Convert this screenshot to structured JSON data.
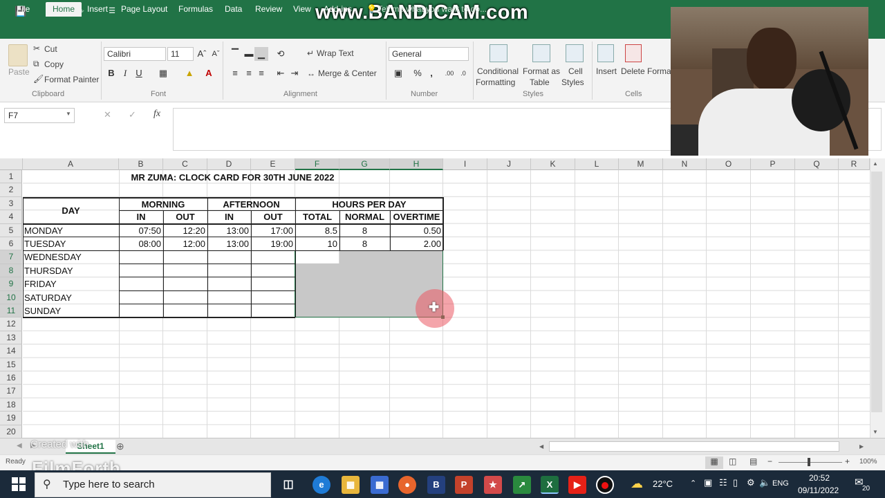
{
  "watermark": "www.BANDICAM.com",
  "filmforth": {
    "line1": "Created with",
    "line2": "FilmForth"
  },
  "ribbon_tabs": [
    "File",
    "Home",
    "Insert",
    "Page Layout",
    "Formulas",
    "Data",
    "Review",
    "View",
    "Add-ins"
  ],
  "tell_me": "Tell me what you want to do...",
  "clipboard": {
    "paste": "Paste",
    "cut": "Cut",
    "copy": "Copy",
    "format_painter": "Format Painter",
    "group": "Clipboard"
  },
  "font": {
    "name": "Calibri",
    "size": "11",
    "group": "Font",
    "bold": "B",
    "italic": "I",
    "underline": "U"
  },
  "alignment": {
    "wrap": "Wrap Text",
    "merge": "Merge & Center",
    "group": "Alignment"
  },
  "number": {
    "format": "General",
    "group": "Number",
    "percent": "%",
    "comma": ","
  },
  "styles": {
    "cond1": "Conditional",
    "cond2": "Formatting",
    "table1": "Format as",
    "table2": "Table",
    "cell1": "Cell",
    "cell2": "Styles",
    "group": "Styles"
  },
  "cells_grp": {
    "insert": "Insert",
    "delete": "Delete",
    "format": "Forma",
    "group": "Cells"
  },
  "namebox": "F7",
  "fx": "fx",
  "columns": [
    "A",
    "B",
    "C",
    "D",
    "E",
    "F",
    "G",
    "H",
    "I",
    "J",
    "K",
    "L",
    "M",
    "N",
    "O",
    "P",
    "Q",
    "R"
  ],
  "rows": [
    "1",
    "2",
    "3",
    "4",
    "5",
    "6",
    "7",
    "8",
    "9",
    "10",
    "11",
    "12",
    "13",
    "14",
    "15",
    "16",
    "17",
    "18",
    "19",
    "20"
  ],
  "sheet": {
    "title": "MR ZUMA: CLOCK CARD FOR 30TH JUNE 2022",
    "day": "DAY",
    "morning": "MORNING",
    "afternoon": "AFTERNOON",
    "hours": "HOURS PER DAY",
    "in1": "IN",
    "out1": "OUT",
    "in2": "IN",
    "out2": "OUT",
    "total": "TOTAL",
    "normal": "NORMAL",
    "overtime": "OVERTIME",
    "days": [
      {
        "name": "MONDAY",
        "m_in": "07:50",
        "m_out": "12:20",
        "a_in": "13:00",
        "a_out": "17:00",
        "total": "8.5",
        "normal": "8",
        "ot": "0.50"
      },
      {
        "name": "TUESDAY",
        "m_in": "08:00",
        "m_out": "12:00",
        "a_in": "13:00",
        "a_out": "19:00",
        "total": "10",
        "normal": "8",
        "ot": "2.00"
      },
      {
        "name": "WEDNESDAY"
      },
      {
        "name": "THURSDAY"
      },
      {
        "name": "FRIDAY"
      },
      {
        "name": "SATURDAY"
      },
      {
        "name": "SUNDAY"
      }
    ]
  },
  "sheet_tab": "Sheet1",
  "status": {
    "ready": "Ready",
    "zoom": "100%"
  },
  "taskbar": {
    "search": "Type here to search",
    "temp": "22°C",
    "lang": "ENG",
    "time": "20:52",
    "date": "09/11/2022",
    "notif": "20"
  },
  "colors": {
    "excel_green": "#217346",
    "selection_fill": "#c8c8c8",
    "taskbar": "#1b2a3a"
  }
}
